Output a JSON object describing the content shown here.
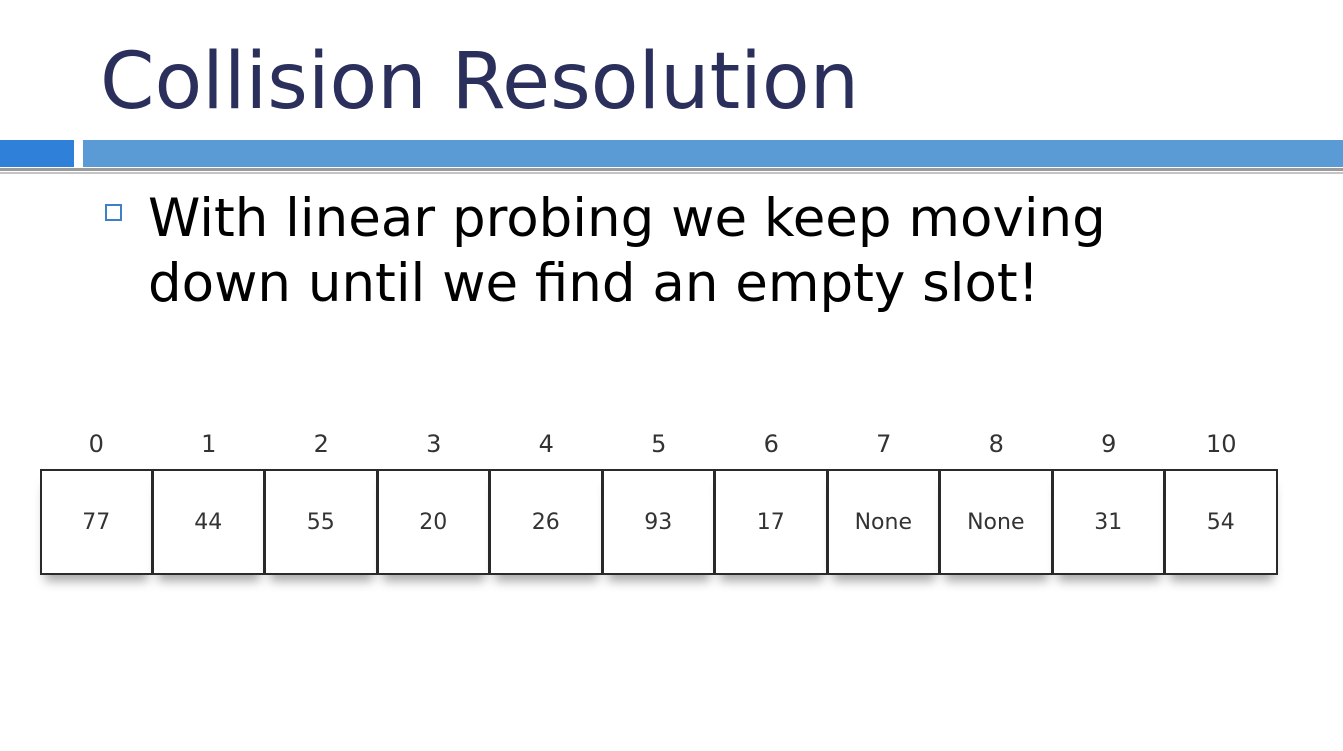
{
  "slide": {
    "title": "Collision Resolution",
    "bullets": [
      "With linear probing we keep moving down until we find an empty slot!"
    ],
    "colors": {
      "title": "#2b2f5b",
      "accent_bar_left": "#2f80d9",
      "accent_bar_right": "#5b9bd5",
      "bullet_marker": "#3f7fc7"
    }
  },
  "hash_table": {
    "slots": [
      {
        "index": "0",
        "value": "77"
      },
      {
        "index": "1",
        "value": "44"
      },
      {
        "index": "2",
        "value": "55"
      },
      {
        "index": "3",
        "value": "20"
      },
      {
        "index": "4",
        "value": "26"
      },
      {
        "index": "5",
        "value": "93"
      },
      {
        "index": "6",
        "value": "17"
      },
      {
        "index": "7",
        "value": "None"
      },
      {
        "index": "8",
        "value": "None"
      },
      {
        "index": "9",
        "value": "31"
      },
      {
        "index": "10",
        "value": "54"
      }
    ]
  }
}
